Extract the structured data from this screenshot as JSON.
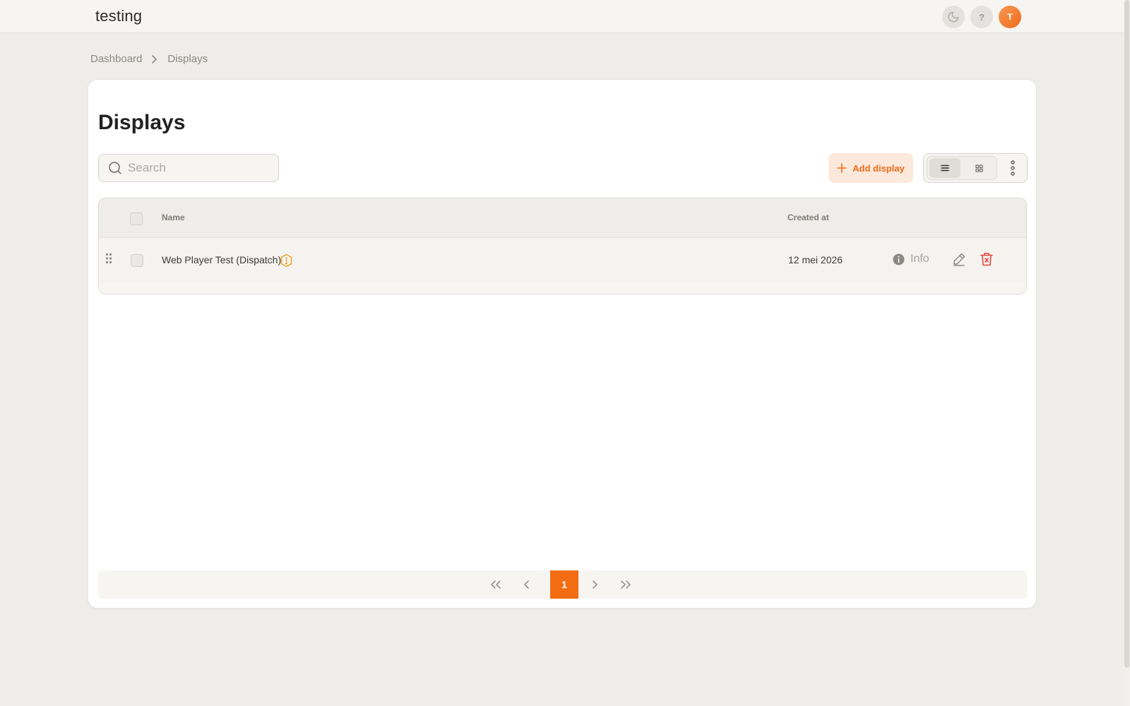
{
  "header": {
    "app_title": "testing",
    "avatar_initial": "T",
    "help_label": "?"
  },
  "breadcrumb": {
    "items": [
      "Dashboard",
      "Displays"
    ]
  },
  "page": {
    "title": "Displays"
  },
  "search": {
    "placeholder": "Search",
    "value": ""
  },
  "toolbar": {
    "add_label": "Add display"
  },
  "table": {
    "columns": [
      "Name",
      "Created at"
    ],
    "rows": [
      {
        "name": "Web Player Test (Dispatch)",
        "created_at": "12 mei 2026",
        "info_label": "Info"
      }
    ]
  },
  "pagination": {
    "current_page": "1"
  },
  "colors": {
    "accent": "#f26d12",
    "accent_soft": "#fde9dc",
    "warning": "#f0a020",
    "danger": "#e5473a"
  },
  "icons": [
    "moon-icon",
    "help-icon",
    "chevron-right-icon",
    "search-icon",
    "plus-icon",
    "list-view-icon",
    "grid-view-icon",
    "more-vertical-icon",
    "drag-handle-icon",
    "warning-icon",
    "info-icon",
    "edit-icon",
    "trash-icon",
    "chevrons-left-icon",
    "chevron-left-icon",
    "chevrons-right-icon"
  ]
}
